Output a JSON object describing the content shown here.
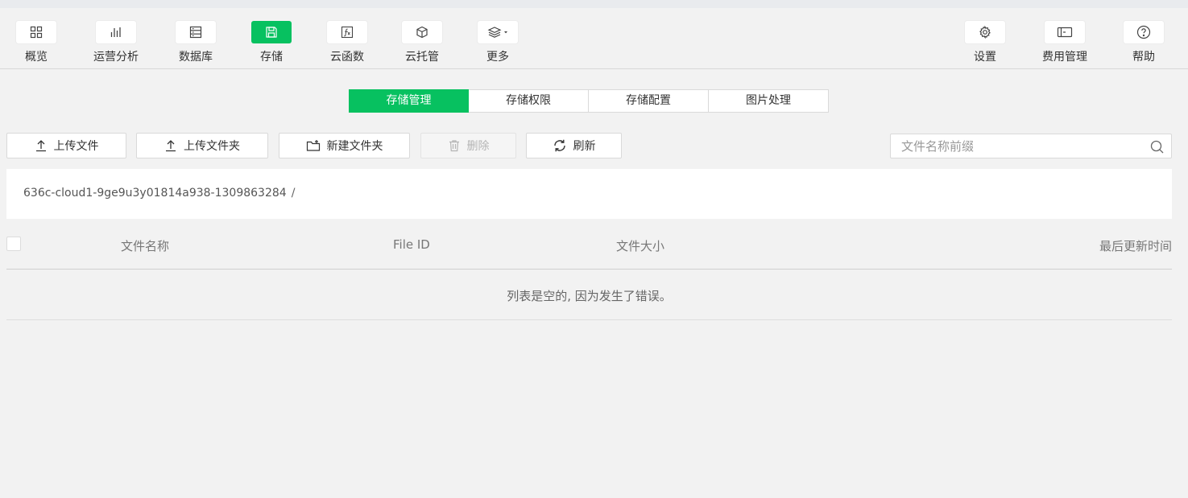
{
  "nav": {
    "items": [
      {
        "label": "概览",
        "icon": "grid-icon"
      },
      {
        "label": "运营分析",
        "icon": "bar-chart-icon"
      },
      {
        "label": "数据库",
        "icon": "database-icon"
      },
      {
        "label": "存储",
        "icon": "save-icon",
        "active": true
      },
      {
        "label": "云函数",
        "icon": "function-icon"
      },
      {
        "label": "云托管",
        "icon": "cube-icon"
      },
      {
        "label": "更多",
        "icon": "layers-icon"
      },
      {
        "label": "设置",
        "icon": "gear-icon"
      },
      {
        "label": "费用管理",
        "icon": "wallet-icon"
      },
      {
        "label": "帮助",
        "icon": "help-icon"
      }
    ]
  },
  "tabs": [
    {
      "label": "存储管理",
      "active": true
    },
    {
      "label": "存储权限"
    },
    {
      "label": "存储配置"
    },
    {
      "label": "图片处理"
    }
  ],
  "toolbar": {
    "upload_file": "上传文件",
    "upload_folder": "上传文件夹",
    "new_folder": "新建文件夹",
    "delete": "删除",
    "refresh": "刷新"
  },
  "search": {
    "placeholder": "文件名称前缀",
    "value": ""
  },
  "path": {
    "bucket": "636c-cloud1-9ge9u3y01814a938-1309863284",
    "separator": "/"
  },
  "table": {
    "columns": [
      "文件名称",
      "File ID",
      "文件大小",
      "最后更新时间"
    ],
    "empty_message": "列表是空的, 因为发生了错误。"
  },
  "colors": {
    "accent": "#07c160",
    "background": "#f2f2f2"
  }
}
